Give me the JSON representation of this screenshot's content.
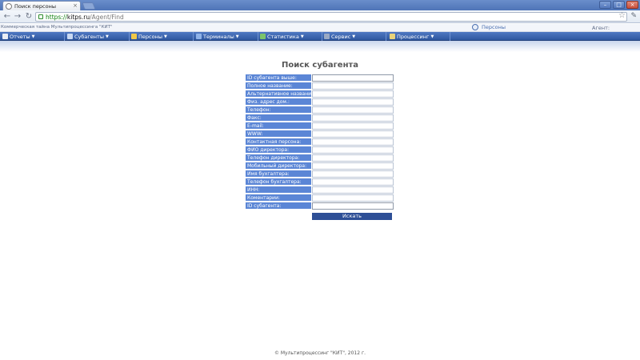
{
  "browser": {
    "tab_title": "Поиск персоны",
    "url": {
      "scheme": "https://",
      "host": "kitps.ru",
      "path": "/Agent/Find"
    }
  },
  "header": {
    "secret_text": "Коммерческая тайна Мультипроцессинга \"КИТ\"",
    "persons_link": "Персоны",
    "agent_label": "Агент:"
  },
  "menu": {
    "items": [
      {
        "label": "Отчеты",
        "icon": "reports-icon"
      },
      {
        "label": "Субагенты",
        "icon": "subagents-icon"
      },
      {
        "label": "Персоны",
        "icon": "persons-icon"
      },
      {
        "label": "Терминалы",
        "icon": "terminals-icon"
      },
      {
        "label": "Статистика",
        "icon": "statistics-icon"
      },
      {
        "label": "Сервис",
        "icon": "service-icon"
      },
      {
        "label": "Процессинг",
        "icon": "processing-icon"
      }
    ]
  },
  "search": {
    "title": "Поиск субагента",
    "fields": [
      "ID субагента выше:",
      "Полное название:",
      "Альтернативное название:",
      "Физ. адрес дом.:",
      "Телефон:",
      "Факс:",
      "E-mail:",
      "WWW:",
      "Контактная персона:",
      "ФИО директора:",
      "Телефон директора:",
      "Мобильный директора:",
      "Имя бухгалтера:",
      "Телефон бухгалтера:",
      "ИНН:",
      "Коментарии:",
      "ID субагента:"
    ],
    "submit_label": "Искать"
  },
  "footer": {
    "copyright": "© Мультипроцессинг \"КИТ\", 2012 г."
  }
}
